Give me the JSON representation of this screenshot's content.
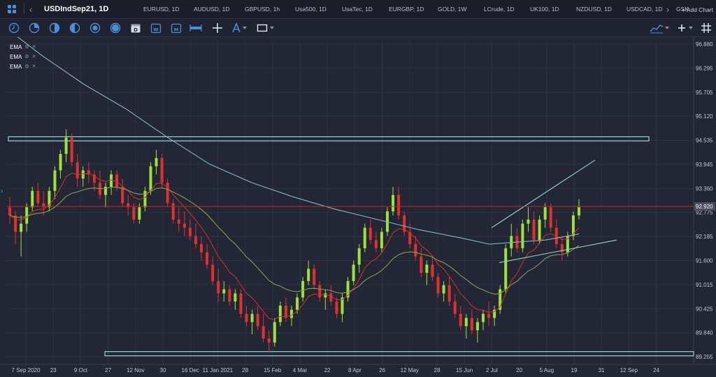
{
  "tabbar": {
    "active_symbol": "USDIndSep21, 1D",
    "symbols": [
      "EURUSD, 1D",
      "AUDUSD, 1D",
      "GBPUSD, 1h",
      "Usa500, 1D",
      "UsaTec, 1D",
      "EURGBP, 1D",
      "GOLD, 1W",
      "LCrude, 1D",
      "UK100, 1D",
      "NZDUSD, 1D",
      "USDCAD, 1D",
      "GSK"
    ],
    "add_chart_label": "+ Add Chart"
  },
  "toolbar": {
    "tools": [
      "clock-icon",
      "timeframe-icon",
      "period-icon",
      "session-icon",
      "calendar-icon",
      "day-icon",
      "week-icon",
      "month-icon",
      "range-icon",
      "crosshair-icon",
      "text-tool-icon",
      "rectangle-tool-icon"
    ],
    "right_tools": [
      "chart-type-icon",
      "settings-icon",
      "grid-icon"
    ]
  },
  "legend": [
    "EMA",
    "EMA",
    "EMA"
  ],
  "colors": {
    "background": "#232634",
    "grid": "#2e3242",
    "up_candle": "#9be23a",
    "down_candle": "#e0312e",
    "ema_fast": "#d2322d",
    "ema_mid": "#7fa343",
    "ema_slow": "#7fb8c6",
    "level_box": "#8fd4dc",
    "price_line": "#c62828",
    "price_label_bg": "#4b4f5e"
  },
  "chart_data": {
    "type": "candlestick",
    "y_axis": [
      "96.880",
      "96.295",
      "95.705",
      "95.120",
      "94.535",
      "93.945",
      "93.360",
      "92.775",
      "92.185",
      "91.600",
      "91.015",
      "90.425",
      "89.840",
      "89.255"
    ],
    "ylim": [
      89.255,
      96.88
    ],
    "x_axis": [
      "7 Sep 2020",
      "23",
      "9 Oct",
      "27",
      "12 Nov",
      "30",
      "16 Dec",
      "11 Jan 2021",
      "28",
      "15 Feb",
      "4 Mar",
      "22",
      "8 Apr",
      "26",
      "12 May",
      "28",
      "15 Jun",
      "2 Jul",
      "20",
      "5 Aug",
      "19",
      "31",
      "12 Sep",
      "24"
    ],
    "current_price": "92.920",
    "candles": [
      [
        92.9,
        93.15,
        92.5,
        92.7
      ],
      [
        92.7,
        92.8,
        92.0,
        92.3
      ],
      [
        92.3,
        92.7,
        91.7,
        92.5
      ],
      [
        92.5,
        93.0,
        92.3,
        92.9
      ],
      [
        92.9,
        93.4,
        92.8,
        93.3
      ],
      [
        93.3,
        93.5,
        92.9,
        93.0
      ],
      [
        93.0,
        93.3,
        92.7,
        92.9
      ],
      [
        92.9,
        93.4,
        92.8,
        93.3
      ],
      [
        93.3,
        93.9,
        93.1,
        93.8
      ],
      [
        93.8,
        94.3,
        93.6,
        94.2
      ],
      [
        94.2,
        94.8,
        94.0,
        94.6
      ],
      [
        94.6,
        94.7,
        93.9,
        94.0
      ],
      [
        94.0,
        94.2,
        93.4,
        93.6
      ],
      [
        93.6,
        93.9,
        93.4,
        93.8
      ],
      [
        93.8,
        94.0,
        93.5,
        93.7
      ],
      [
        93.7,
        93.8,
        93.3,
        93.5
      ],
      [
        93.5,
        93.8,
        93.1,
        93.2
      ],
      [
        93.2,
        93.5,
        92.9,
        93.4
      ],
      [
        93.4,
        93.8,
        93.2,
        93.7
      ],
      [
        93.7,
        93.8,
        93.3,
        93.4
      ],
      [
        93.4,
        93.6,
        92.9,
        93.0
      ],
      [
        93.0,
        93.2,
        92.7,
        92.9
      ],
      [
        92.9,
        93.0,
        92.5,
        92.6
      ],
      [
        92.6,
        93.0,
        92.5,
        92.9
      ],
      [
        92.9,
        93.4,
        92.8,
        93.3
      ],
      [
        93.3,
        94.0,
        93.2,
        93.9
      ],
      [
        93.9,
        94.3,
        93.7,
        94.1
      ],
      [
        94.1,
        94.2,
        93.4,
        93.5
      ],
      [
        93.5,
        93.6,
        92.9,
        93.0
      ],
      [
        93.0,
        93.1,
        92.5,
        92.6
      ],
      [
        92.6,
        92.9,
        92.3,
        92.5
      ],
      [
        92.5,
        92.8,
        92.2,
        92.4
      ],
      [
        92.4,
        92.6,
        92.1,
        92.2
      ],
      [
        92.2,
        92.5,
        91.9,
        92.0
      ],
      [
        92.0,
        92.2,
        91.6,
        91.8
      ],
      [
        91.8,
        92.0,
        91.4,
        91.5
      ],
      [
        91.5,
        91.7,
        91.0,
        91.1
      ],
      [
        91.1,
        91.4,
        90.6,
        90.8
      ],
      [
        90.8,
        91.1,
        90.6,
        90.9
      ],
      [
        90.9,
        91.0,
        90.5,
        90.6
      ],
      [
        90.6,
        90.9,
        90.4,
        90.8
      ],
      [
        90.8,
        90.9,
        90.2,
        90.3
      ],
      [
        90.3,
        90.5,
        90.0,
        90.1
      ],
      [
        90.1,
        90.4,
        89.8,
        90.3
      ],
      [
        90.3,
        90.5,
        89.9,
        90.0
      ],
      [
        90.0,
        90.3,
        89.6,
        89.7
      ],
      [
        89.7,
        89.9,
        89.35,
        89.6
      ],
      [
        89.6,
        90.2,
        89.5,
        90.1
      ],
      [
        90.1,
        90.6,
        90.0,
        90.5
      ],
      [
        90.5,
        90.7,
        90.1,
        90.2
      ],
      [
        90.2,
        90.5,
        90.0,
        90.4
      ],
      [
        90.4,
        90.8,
        90.3,
        90.7
      ],
      [
        90.7,
        91.2,
        90.6,
        91.1
      ],
      [
        91.1,
        91.6,
        91.0,
        91.4
      ],
      [
        91.4,
        91.5,
        90.9,
        91.0
      ],
      [
        91.0,
        91.1,
        90.6,
        90.7
      ],
      [
        90.7,
        90.9,
        90.4,
        90.8
      ],
      [
        90.8,
        91.0,
        90.5,
        90.6
      ],
      [
        90.6,
        90.7,
        90.2,
        90.3
      ],
      [
        90.3,
        90.8,
        90.1,
        90.7
      ],
      [
        90.7,
        91.2,
        90.6,
        91.1
      ],
      [
        91.1,
        91.6,
        91.0,
        91.5
      ],
      [
        91.5,
        92.0,
        91.3,
        91.9
      ],
      [
        91.9,
        92.5,
        91.8,
        92.4
      ],
      [
        92.4,
        92.6,
        92.0,
        92.1
      ],
      [
        92.1,
        92.3,
        91.8,
        91.9
      ],
      [
        91.9,
        92.4,
        91.8,
        92.3
      ],
      [
        92.3,
        92.9,
        92.2,
        92.8
      ],
      [
        92.8,
        93.4,
        92.7,
        93.2
      ],
      [
        93.2,
        93.4,
        92.6,
        92.7
      ],
      [
        92.7,
        92.8,
        92.2,
        92.3
      ],
      [
        92.3,
        92.5,
        91.9,
        92.0
      ],
      [
        92.0,
        92.2,
        91.6,
        91.7
      ],
      [
        91.7,
        91.9,
        91.2,
        91.3
      ],
      [
        91.3,
        91.6,
        91.0,
        91.5
      ],
      [
        91.5,
        91.7,
        91.1,
        91.2
      ],
      [
        91.2,
        91.3,
        90.7,
        90.8
      ],
      [
        90.8,
        91.1,
        90.6,
        91.0
      ],
      [
        91.0,
        91.2,
        90.5,
        90.6
      ],
      [
        90.6,
        90.8,
        90.2,
        90.3
      ],
      [
        90.3,
        90.5,
        89.9,
        90.0
      ],
      [
        90.0,
        90.3,
        89.7,
        90.2
      ],
      [
        90.2,
        90.4,
        89.8,
        89.9
      ],
      [
        89.9,
        90.2,
        89.6,
        90.1
      ],
      [
        90.1,
        90.4,
        89.9,
        90.3
      ],
      [
        90.3,
        90.6,
        90.0,
        90.2
      ],
      [
        90.2,
        90.5,
        90.0,
        90.4
      ],
      [
        90.4,
        91.0,
        90.3,
        90.9
      ],
      [
        90.9,
        92.0,
        90.8,
        91.9
      ],
      [
        91.9,
        92.5,
        91.7,
        92.2
      ],
      [
        92.2,
        92.4,
        91.8,
        91.9
      ],
      [
        91.9,
        92.6,
        91.8,
        92.5
      ],
      [
        92.5,
        92.9,
        92.3,
        92.6
      ],
      [
        92.6,
        92.8,
        92.0,
        92.1
      ],
      [
        92.1,
        92.7,
        92.0,
        92.6
      ],
      [
        92.6,
        93.0,
        92.4,
        92.9
      ],
      [
        92.9,
        93.0,
        92.3,
        92.4
      ],
      [
        92.4,
        92.6,
        91.9,
        92.0
      ],
      [
        92.0,
        92.2,
        91.6,
        91.8
      ],
      [
        91.8,
        92.3,
        91.7,
        92.2
      ],
      [
        92.2,
        92.8,
        92.1,
        92.7
      ],
      [
        92.7,
        93.1,
        92.6,
        92.9
      ]
    ]
  }
}
